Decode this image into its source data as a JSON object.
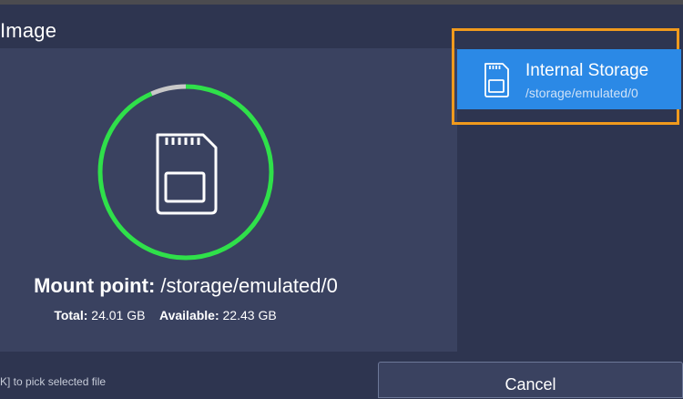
{
  "dialog": {
    "title": "Image"
  },
  "storage_info": {
    "mount_label": "Mount point:",
    "mount_path": "/storage/emulated/0",
    "total_label": "Total:",
    "total_value": "24.01 GB",
    "available_label": "Available:",
    "available_value": "22.43 GB",
    "used_fraction": 0.066,
    "ring_icon": "sd-card-icon"
  },
  "storage_list": {
    "items": [
      {
        "title": "Internal Storage",
        "path": "/storage/emulated/0",
        "icon": "sd-card-icon",
        "selected": true
      }
    ]
  },
  "footer": {
    "hint": "K] to pick selected file",
    "cancel_label": "Cancel"
  },
  "colors": {
    "accent": "#2b89e6",
    "focus": "#f09a1d",
    "ring_free": "#2fe04a",
    "ring_used": "#c8c8c8",
    "background": "#2e3550",
    "panel": "#3a4260"
  }
}
